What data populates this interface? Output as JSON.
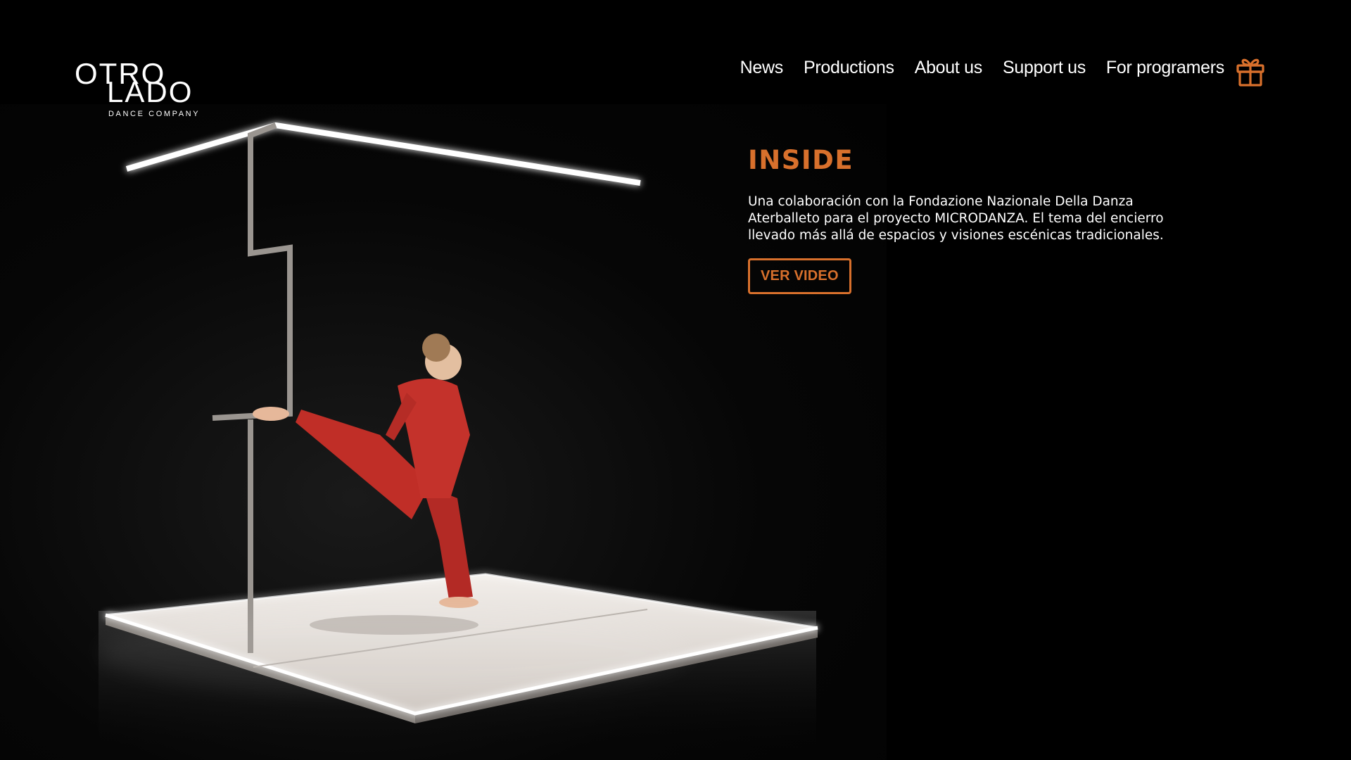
{
  "brand": {
    "logo_line1": "OTRO",
    "logo_line2": "LADO",
    "logo_sub": "DANCE COMPANY"
  },
  "nav": {
    "items": [
      {
        "label": "News"
      },
      {
        "label": "Productions"
      },
      {
        "label": "About us"
      },
      {
        "label": "Support us"
      },
      {
        "label": "For programers"
      }
    ],
    "gift_icon": "gift-icon"
  },
  "hero": {
    "image_alt": "Dancer in red costume inside a glowing light-frame cube on a dark stage"
  },
  "feature": {
    "title": "INSIDE",
    "description": "Una colaboración con la Fondazione Nazionale Della Danza Aterballeto para el proyecto MICRODANZA. El tema del encierro llevado más allá de espacios y visiones escénicas tradicionales.",
    "button_label": "VER VIDEO"
  },
  "colors": {
    "background": "#000000",
    "accent": "#d8702c",
    "text": "#ffffff"
  }
}
